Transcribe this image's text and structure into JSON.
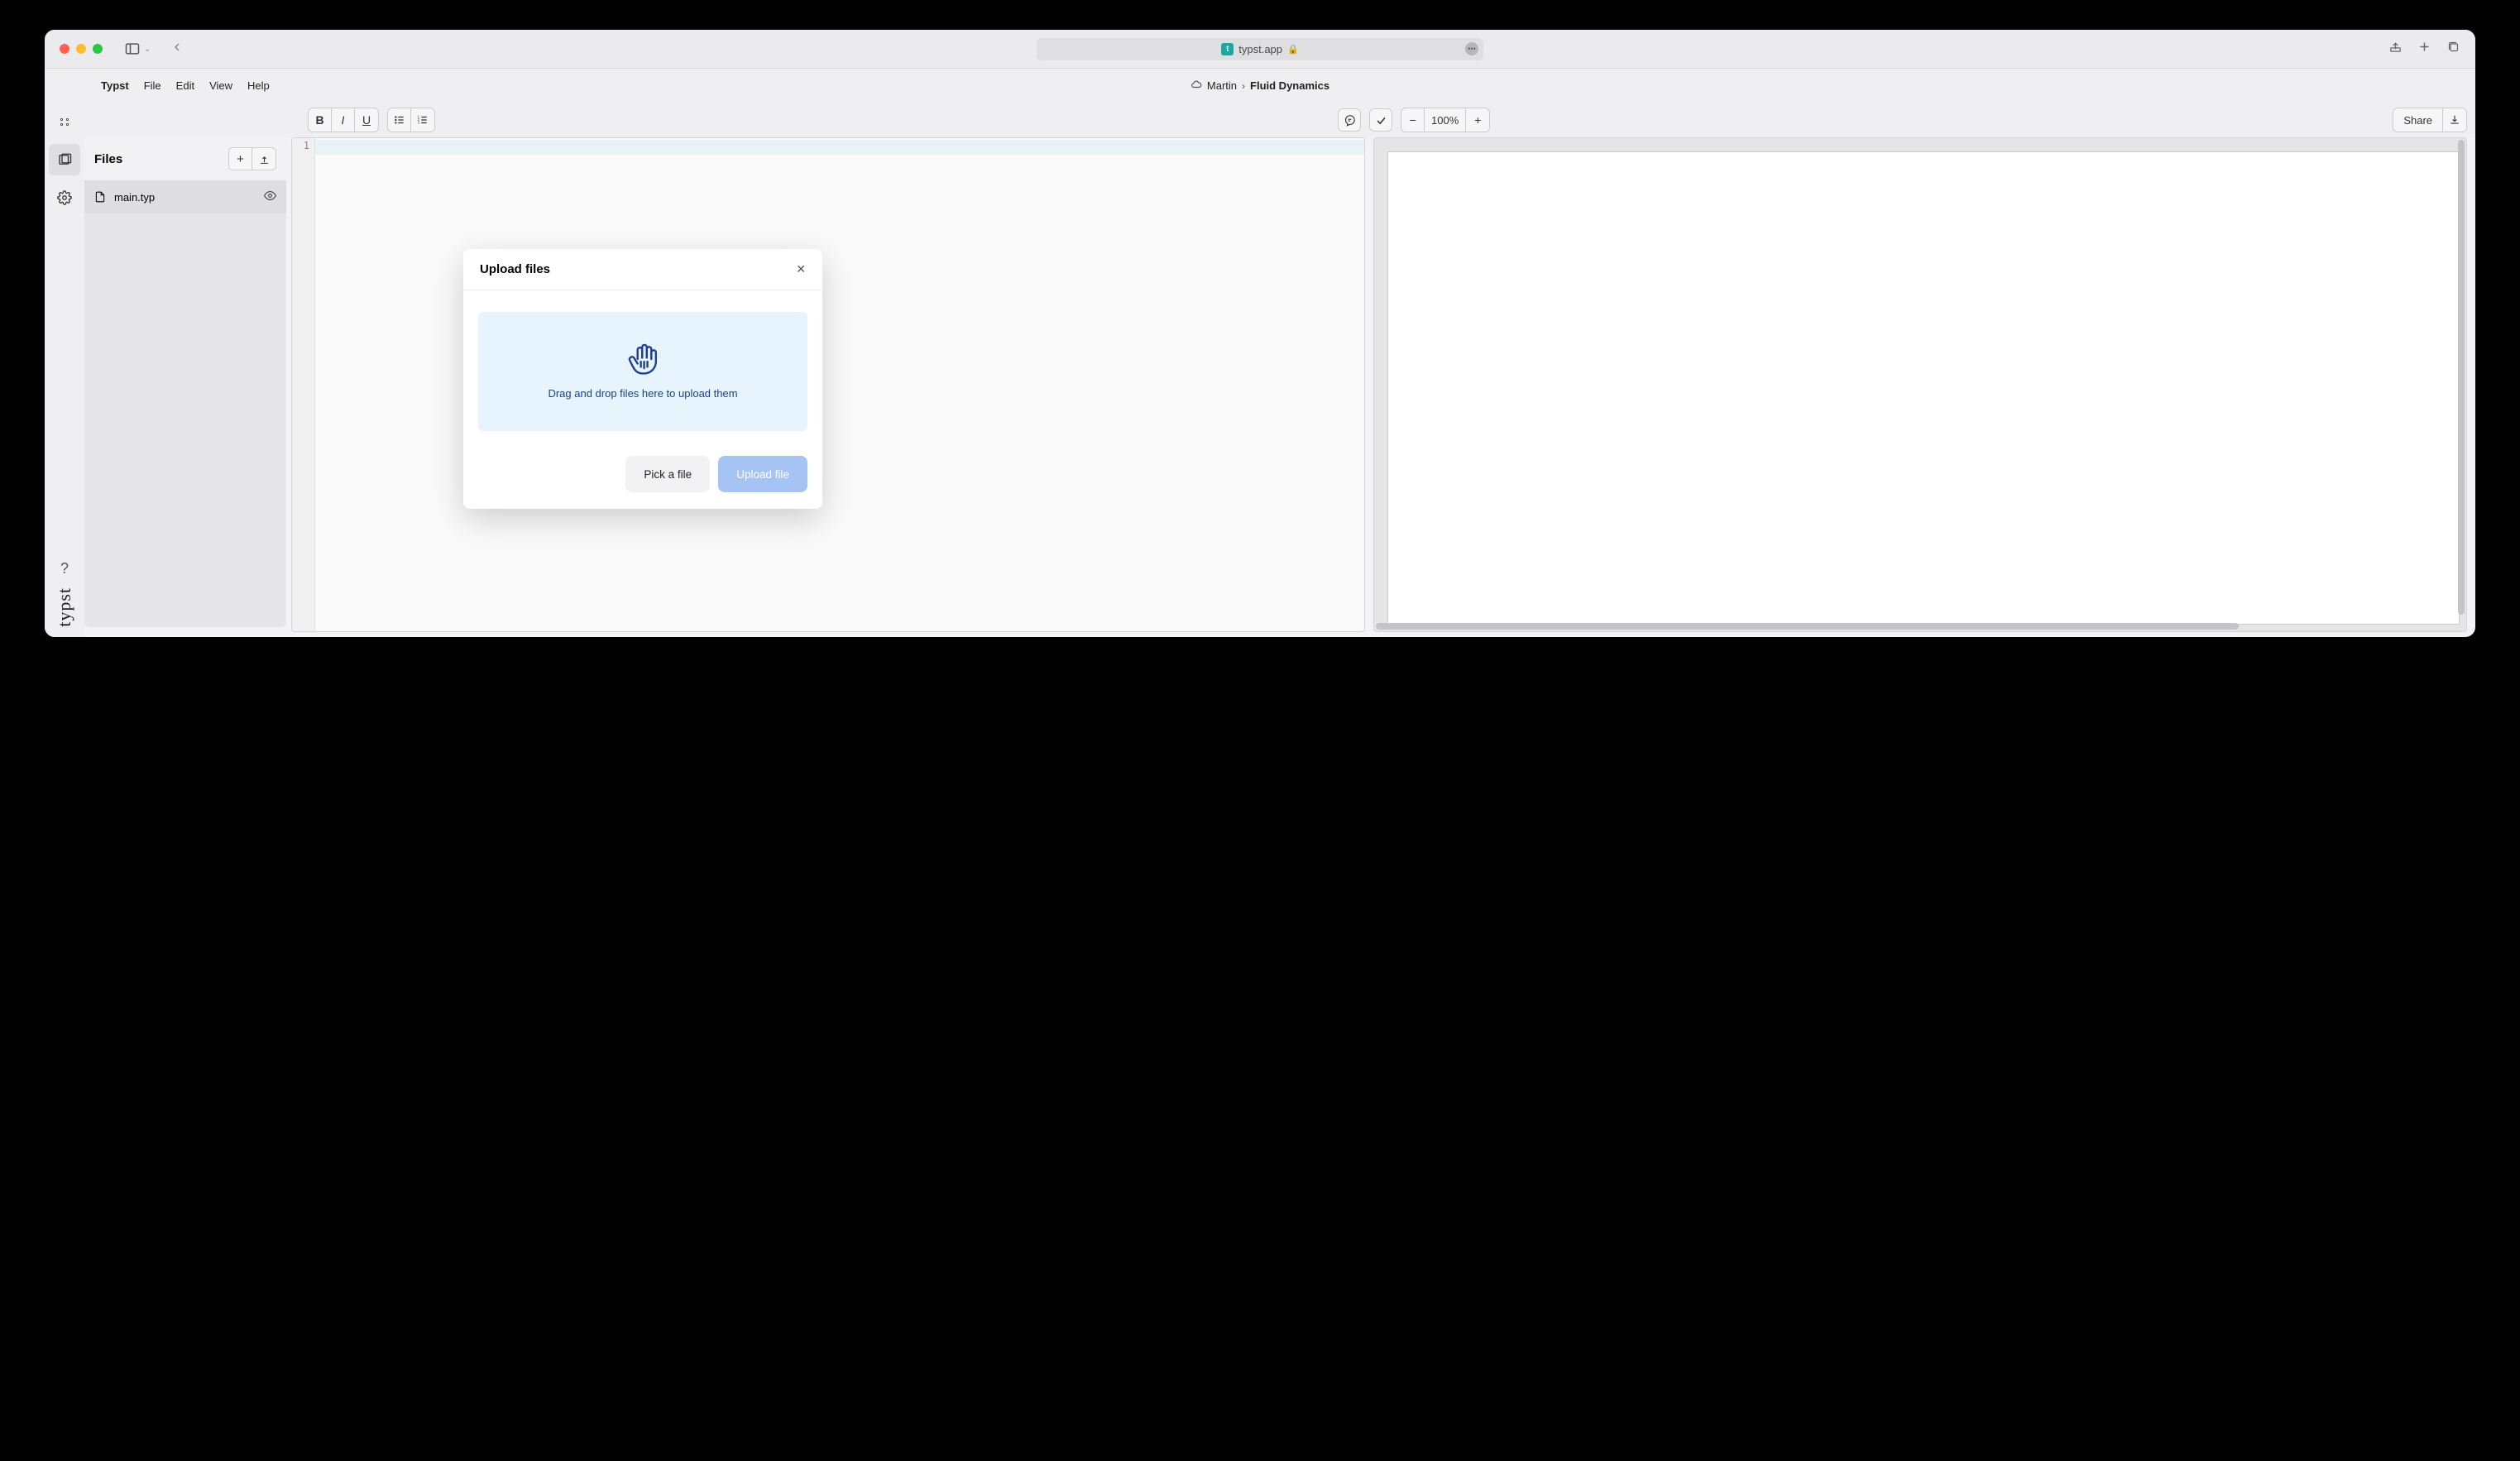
{
  "browser": {
    "url": "typst.app",
    "favicon_letter": "t"
  },
  "menu": {
    "brand": "Typst",
    "items": [
      "File",
      "Edit",
      "View",
      "Help"
    ]
  },
  "breadcrumb": {
    "user": "Martin",
    "project": "Fluid Dynamics"
  },
  "toolbar": {
    "zoom": "100%",
    "share": "Share"
  },
  "sidebar": {
    "title": "Files",
    "file": "main.typ"
  },
  "editor": {
    "line_number": "1"
  },
  "modal": {
    "title": "Upload files",
    "dropzone_text": "Drag and drop files here to upload them",
    "pick_button": "Pick a file",
    "upload_button": "Upload file"
  },
  "logo": "typst"
}
